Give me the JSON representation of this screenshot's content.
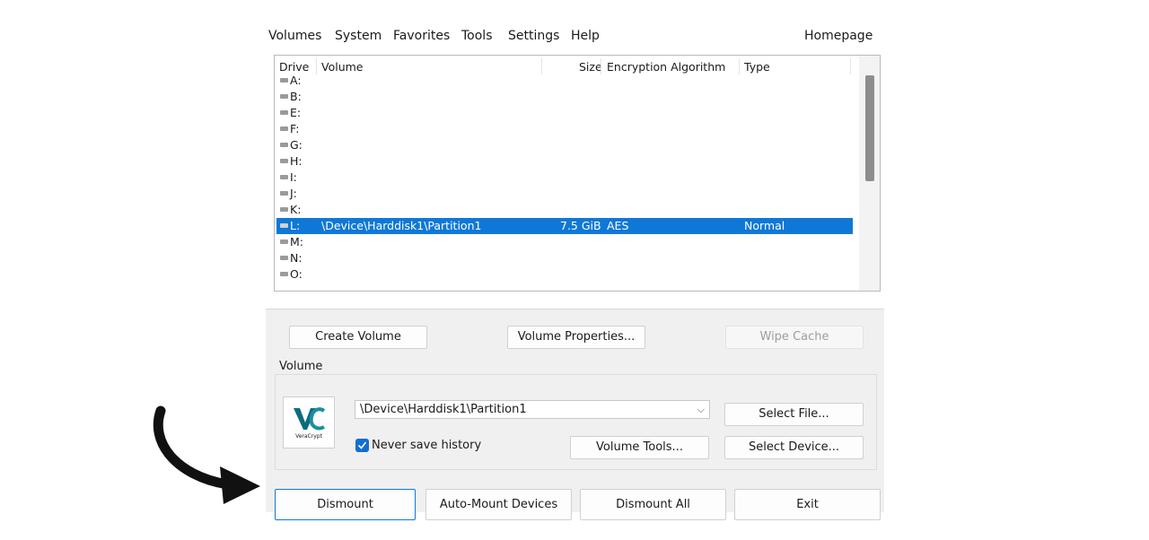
{
  "menubar": {
    "items": [
      "Volumes",
      "System",
      "Favorites",
      "Tools",
      "Settings",
      "Help"
    ],
    "homepage": "Homepage"
  },
  "drive_list": {
    "headers": {
      "drive": "Drive",
      "volume": "Volume",
      "size": "Size",
      "algorithm": "Encryption Algorithm",
      "type": "Type"
    },
    "rows": [
      {
        "drive": "A:",
        "volume": "",
        "size": "",
        "algorithm": "",
        "type": ""
      },
      {
        "drive": "B:",
        "volume": "",
        "size": "",
        "algorithm": "",
        "type": ""
      },
      {
        "drive": "E:",
        "volume": "",
        "size": "",
        "algorithm": "",
        "type": ""
      },
      {
        "drive": "F:",
        "volume": "",
        "size": "",
        "algorithm": "",
        "type": ""
      },
      {
        "drive": "G:",
        "volume": "",
        "size": "",
        "algorithm": "",
        "type": ""
      },
      {
        "drive": "H:",
        "volume": "",
        "size": "",
        "algorithm": "",
        "type": ""
      },
      {
        "drive": "I:",
        "volume": "",
        "size": "",
        "algorithm": "",
        "type": ""
      },
      {
        "drive": "J:",
        "volume": "",
        "size": "",
        "algorithm": "",
        "type": ""
      },
      {
        "drive": "K:",
        "volume": "",
        "size": "",
        "algorithm": "",
        "type": ""
      },
      {
        "drive": "L:",
        "volume": "\\Device\\Harddisk1\\Partition1",
        "size": "7.5 GiB",
        "algorithm": "AES",
        "type": "Normal",
        "selected": true
      },
      {
        "drive": "M:",
        "volume": "",
        "size": "",
        "algorithm": "",
        "type": ""
      },
      {
        "drive": "N:",
        "volume": "",
        "size": "",
        "algorithm": "",
        "type": ""
      },
      {
        "drive": "O:",
        "volume": "",
        "size": "",
        "algorithm": "",
        "type": ""
      }
    ]
  },
  "actions": {
    "create_volume": "Create Volume",
    "volume_properties": "Volume Properties...",
    "wipe_cache": "Wipe Cache"
  },
  "volume": {
    "label": "Volume",
    "path": "\\Device\\Harddisk1\\Partition1",
    "never_save_history": "Never save history",
    "never_save_checked": true,
    "select_file": "Select File...",
    "volume_tools": "Volume Tools...",
    "select_device": "Select Device...",
    "logo_text": "VeraCrypt"
  },
  "bottom": {
    "dismount": "Dismount",
    "auto_mount": "Auto-Mount Devices",
    "dismount_all": "Dismount All",
    "exit": "Exit"
  },
  "colors": {
    "selection": "#0f78d7",
    "checkbox": "#0f6fd0",
    "logo_primary": "#0d6c7c",
    "arrow": "#111111"
  }
}
